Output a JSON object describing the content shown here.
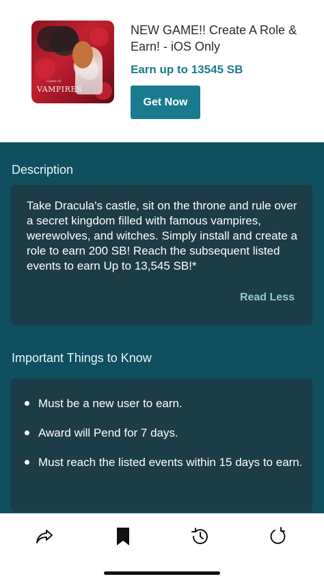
{
  "offer": {
    "title": "NEW GAME!! Create A Role & Earn! - iOS Only",
    "earn_text": "Earn up to 13545 SB",
    "button_label": "Get Now",
    "image": {
      "logo_small": "Game of",
      "logo_text": "VAMPIRES"
    }
  },
  "description": {
    "heading": "Description",
    "text": "Take Dracula's castle, sit on the throne and rule over a secret kingdom filled with famous vampires, werewolves, and witches. Simply install and create a role to earn 200 SB! Reach the subsequent listed events to earn Up to 13,545 SB!*",
    "toggle_label": "Read Less"
  },
  "important": {
    "heading": "Important Things to Know",
    "items": [
      "Must be a new user to earn.",
      "Award will Pend for 7 days.",
      "Must reach the listed events within 15 days to earn."
    ]
  },
  "toolbar": {
    "icons": [
      "share-icon",
      "bookmark-icon",
      "history-icon",
      "refresh-icon"
    ]
  },
  "colors": {
    "accent": "#1a7b8f",
    "content_bg": "#0f4f5e",
    "card_bg": "#1c3c47",
    "link": "#8fcad6"
  }
}
